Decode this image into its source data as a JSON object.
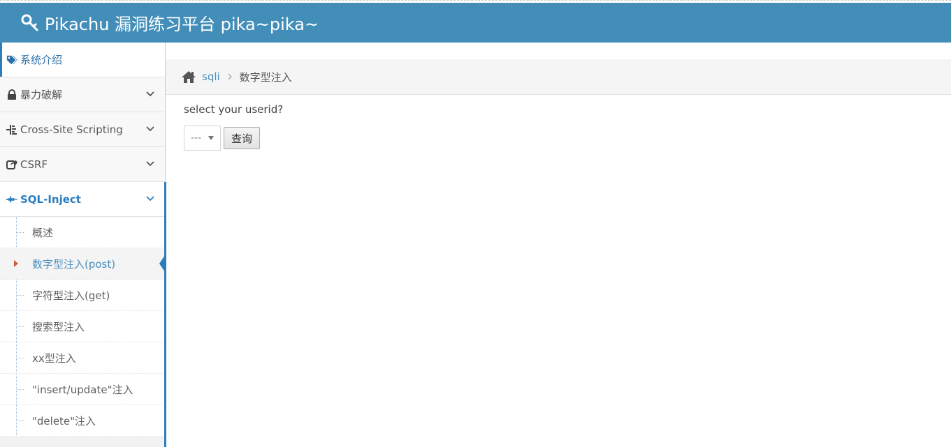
{
  "header": {
    "brand": "Pikachu 漏洞练习平台 pika~pika~",
    "brand_icon": "key-icon",
    "bg_color": "#438eb9"
  },
  "sidebar": {
    "items": [
      {
        "label": "系统介绍",
        "icon": "tags-icon"
      },
      {
        "label": "暴力破解",
        "icon": "lock-icon"
      },
      {
        "label": "Cross-Site Scripting",
        "icon": "tree-icon"
      },
      {
        "label": "CSRF",
        "icon": "share-icon"
      },
      {
        "label": "SQL-Inject",
        "icon": "syringe-icon"
      }
    ],
    "submenu": [
      {
        "label": "概述"
      },
      {
        "label": "数字型注入(post)"
      },
      {
        "label": "字符型注入(get)"
      },
      {
        "label": "搜索型注入"
      },
      {
        "label": "xx型注入"
      },
      {
        "label": "\"insert/update\"注入"
      },
      {
        "label": "\"delete\"注入"
      }
    ],
    "accent_color": "#2b7dbc"
  },
  "breadcrumb": {
    "home_icon": "home-icon",
    "link": "sqli",
    "current": "数字型注入"
  },
  "main": {
    "prompt": "select your userid?",
    "select_value": "---",
    "submit_label": "查询"
  }
}
